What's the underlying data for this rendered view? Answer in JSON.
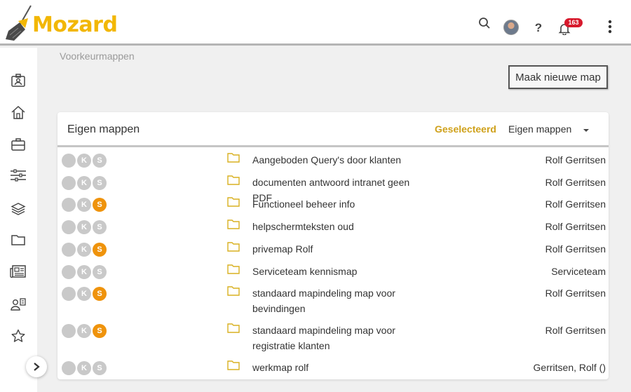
{
  "app": {
    "logo_text": "Mozard"
  },
  "header": {
    "notification_count": "163",
    "icons": [
      "search-icon",
      "avatar",
      "help-icon",
      "bell-icon",
      "more-vertical-icon"
    ]
  },
  "sidebar": {
    "icons": [
      "contact-card-icon",
      "home-icon",
      "briefcase-icon",
      "sliders-icon",
      "layers-icon",
      "folder-icon",
      "newspaper-icon",
      "user-assign-icon",
      "star-icon"
    ],
    "expand_icon": "chevron-right-icon"
  },
  "breadcrumb": "Voorkeurmappen",
  "actions": {
    "new_map_label": "Maak nieuwe map"
  },
  "panel": {
    "title": "Eigen mappen",
    "selected_label": "Geselecteerd",
    "selected_value": "Eigen mappen"
  },
  "colors": {
    "accent": "#f2b705",
    "orange": "#ef930c",
    "badge": "#d7192c"
  },
  "rows": [
    {
      "name": "Aangeboden Query's door klanten",
      "owner": "Rolf Gerritsen",
      "k": "K",
      "s": "S",
      "s_active": false
    },
    {
      "name": "documenten antwoord intranet geen PDF",
      "owner": "Rolf Gerritsen",
      "k": "K",
      "s": "S",
      "s_active": false
    },
    {
      "name": "Functioneel beheer info",
      "owner": "Rolf Gerritsen",
      "k": "K",
      "s": "S",
      "s_active": true
    },
    {
      "name": "helpschermteksten oud",
      "owner": "Rolf Gerritsen",
      "k": "K",
      "s": "S",
      "s_active": false
    },
    {
      "name": "privemap Rolf",
      "owner": "Rolf Gerritsen",
      "k": "K",
      "s": "S",
      "s_active": true
    },
    {
      "name": "Serviceteam kennismap",
      "owner": "Serviceteam",
      "k": "K",
      "s": "S",
      "s_active": false
    },
    {
      "name": "standaard mapindeling map voor bevindingen",
      "owner": "Rolf Gerritsen",
      "k": "K",
      "s": "S",
      "s_active": true
    },
    {
      "name": "standaard mapindeling map voor registratie klanten",
      "owner": "Rolf Gerritsen",
      "k": "K",
      "s": "S",
      "s_active": true
    },
    {
      "name": "werkmap rolf",
      "owner": "Gerritsen, Rolf ()",
      "k": "K",
      "s": "S",
      "s_active": false
    }
  ]
}
